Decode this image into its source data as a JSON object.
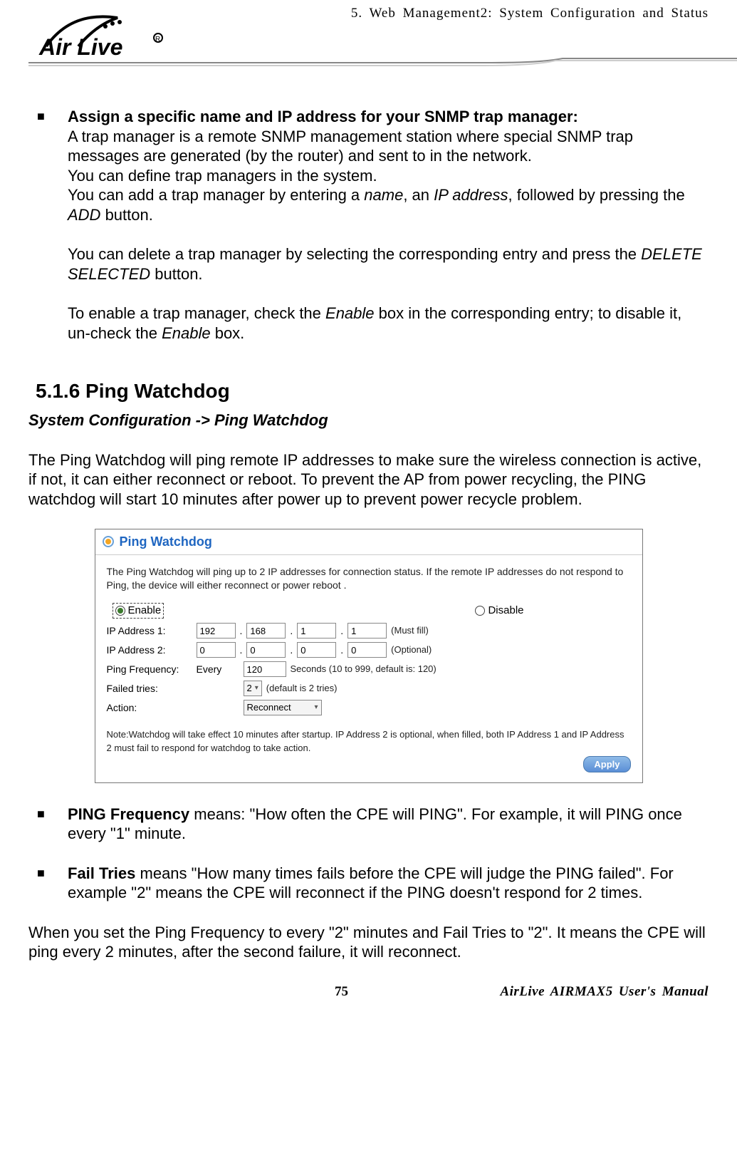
{
  "header": {
    "chapter": "5.  Web Management2: System Configuration and Status",
    "logo_svg_alt": "Air Live"
  },
  "snmp": {
    "title": "Assign a specific name and IP address for your SNMP trap manager:",
    "p1": "A trap manager is a remote SNMP management station where special SNMP trap messages are generated (by the router) and sent to in the network.",
    "p2": "You can define trap managers in the system.",
    "p3a": "You can add a trap manager by entering a ",
    "p3_name": "name",
    "p3b": ", an ",
    "p3_ip": "IP address",
    "p3c": ", followed by pressing the ",
    "p3_add": "ADD",
    "p3d": " button.",
    "p4a": "You can delete a trap manager by selecting the corresponding entry and press the ",
    "p4_del": "DELETE SELECTED",
    "p4b": " button.",
    "p5a": "To enable a trap manager, check the ",
    "p5_enable1": "Enable",
    "p5b": " box in the corresponding entry; to disable it, un-check the ",
    "p5_enable2": "Enable",
    "p5c": " box."
  },
  "section": {
    "num_title": "5.1.6 Ping Watchdog",
    "breadcrumb": "System Configuration -> Ping Watchdog",
    "intro": "The Ping Watchdog will ping remote IP addresses to make sure the wireless connection is active, if not, it can either reconnect or reboot.    To prevent the AP from power recycling, the PING watchdog will start 10 minutes after power up to prevent power recycle problem."
  },
  "panel": {
    "title": "Ping Watchdog",
    "desc": "The Ping Watchdog will ping up to 2 IP addresses for connection status. If the remote IP addresses do not respond to Ping, the device will either reconnect or power reboot .",
    "enable": "Enable",
    "disable": "Disable",
    "ip1_label": "IP Address 1:",
    "ip1": {
      "a": "192",
      "b": "168",
      "c": "1",
      "d": "1"
    },
    "ip1_hint": "(Must fill)",
    "ip2_label": "IP Address 2:",
    "ip2": {
      "a": "0",
      "b": "0",
      "c": "0",
      "d": "0"
    },
    "ip2_hint": "(Optional)",
    "freq_label": "Ping Frequency:",
    "freq_every": "Every",
    "freq_value": "120",
    "freq_hint": "Seconds (10 to 999, default is: 120)",
    "tries_label": "Failed tries:",
    "tries_value": "2",
    "tries_hint": "(default is 2 tries)",
    "action_label": "Action:",
    "action_value": "Reconnect",
    "note": "Note:Watchdog will take effect 10 minutes after startup. IP Address 2 is optional, when filled, both IP Address 1 and IP Address 2 must fail to respond for watchdog to take action.",
    "apply": "Apply"
  },
  "bullets": {
    "ping_freq_bold": "PING Frequency",
    "ping_freq_text": " means: \"How often the CPE will PING\".  For example, it will PING once every \"1\" minute.",
    "fail_bold": "Fail Tries",
    "fail_text": " means \"How many times fails before the CPE will judge the PING failed\".  For example \"2\" means the CPE will reconnect if the PING doesn't respond for 2 times."
  },
  "closing": "When you set the Ping Frequency to every \"2\" minutes and Fail Tries to \"2\".  It means the CPE will ping every 2 minutes, after the second failure, it will reconnect.",
  "footer": {
    "page": "75",
    "manual": "AirLive AIRMAX5 User's Manual"
  }
}
